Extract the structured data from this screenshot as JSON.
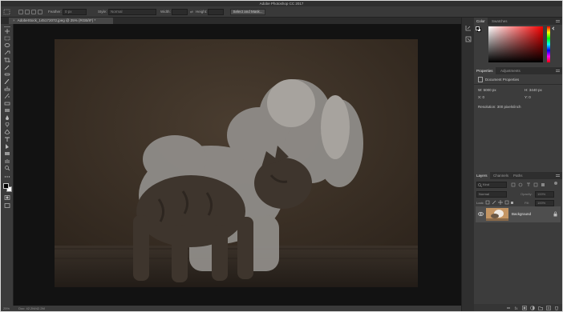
{
  "app": {
    "window_title": "Adobe Photoshop CC 2017"
  },
  "options_bar": {
    "feather_label": "Feather:",
    "feather_value": "0 px",
    "style_label": "Style:",
    "style_value": "Normal",
    "width_label": "Width:",
    "height_label": "Height:",
    "select_mask_label": "Select and Mask..."
  },
  "document_tab": {
    "close": "×",
    "label": "AdobeStock_145172072.jpeg @ 25% (RGB/8*) *"
  },
  "tools": [
    "move-tool",
    "marquee-tool",
    "lasso-tool",
    "quick-select-tool",
    "crop-tool",
    "eyedropper-tool",
    "healing-tool",
    "brush-tool",
    "clone-stamp-tool",
    "history-brush-tool",
    "eraser-tool",
    "gradient-tool",
    "blur-tool",
    "dodge-tool",
    "pen-tool",
    "type-tool",
    "path-select-tool",
    "shape-tool",
    "hand-tool",
    "zoom-tool",
    "edit-toolbar",
    "foreground-color",
    "background-color",
    "quick-mask",
    "screen-mode"
  ],
  "status_bar": {
    "zoom": "25%",
    "doc_info": "Doc: 42.2M/42.2M"
  },
  "color_panel": {
    "tabs": [
      "Color",
      "Swatches"
    ],
    "active_tab": "Color",
    "hue_color": "#ff0000"
  },
  "properties_panel": {
    "tabs": [
      "Properties",
      "Adjustments"
    ],
    "active_tab": "Properties",
    "section_title": "Document Properties",
    "width": "W: 5000 px",
    "height": "H: 3440 px",
    "x": "X: 0",
    "y": "Y: 0",
    "resolution": "Resolution: 300 pixels/inch"
  },
  "layers_panel": {
    "tabs": [
      "Layers",
      "Channels",
      "Paths"
    ],
    "active_tab": "Layers",
    "filter_label": "Kind",
    "blend_mode": "Normal",
    "opacity_label": "Opacity:",
    "opacity_value": "100%",
    "lock_label": "Lock:",
    "fill_label": "Fill:",
    "fill_value": "100%",
    "layers": [
      {
        "name": "Background",
        "visible": true,
        "locked": true
      }
    ]
  },
  "colors": {
    "canvas_bg": "#121212",
    "panel_bg": "#3c3c3c",
    "selected_layer": "#4e4e4e"
  }
}
